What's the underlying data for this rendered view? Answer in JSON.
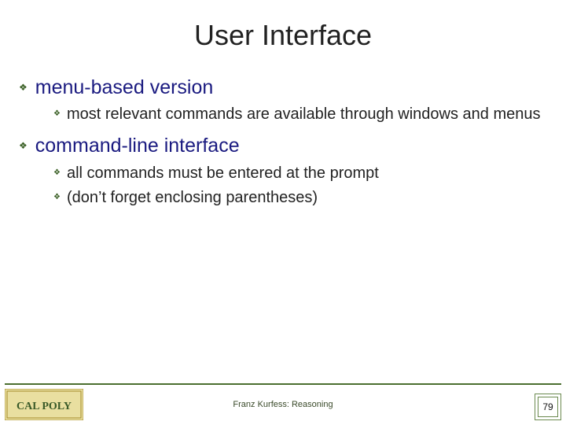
{
  "title": "User Interface",
  "items": [
    {
      "label": "menu-based version",
      "children": [
        {
          "label": "most relevant commands are available through windows and menus"
        }
      ]
    },
    {
      "label": "command-line interface",
      "children": [
        {
          "label": "all commands must be entered at the prompt"
        },
        {
          "label": "(don’t forget enclosing parentheses)"
        }
      ]
    }
  ],
  "footer": {
    "center": "Franz Kurfess: Reasoning"
  },
  "page_number": "79",
  "logo_text": "CAL POLY",
  "colors": {
    "accent": "#385e23",
    "heading": "#1a1a80"
  },
  "icons": {
    "bullet": "❖"
  }
}
